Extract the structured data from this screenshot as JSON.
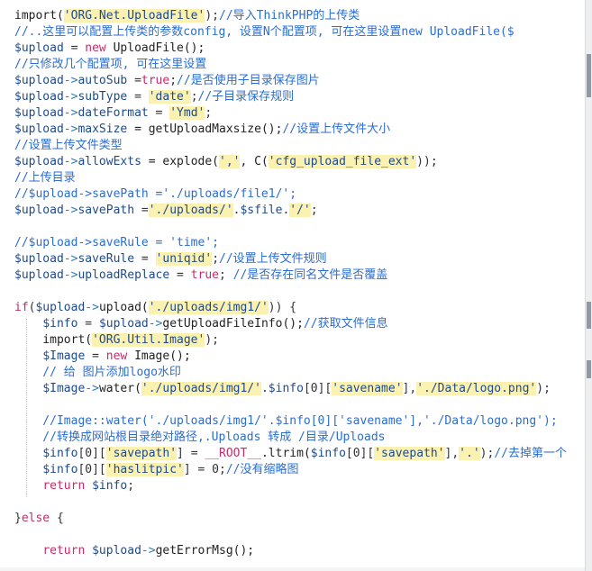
{
  "code_lines": [
    [
      {
        "t": "import(",
        "c": "fn"
      },
      {
        "t": "'ORG.Net.UploadFile'",
        "c": "str"
      },
      {
        "t": ");",
        "c": "opr"
      },
      {
        "t": "//导入ThinkPHP的上传类",
        "c": "cmt"
      }
    ],
    [
      {
        "t": "//..这里可以配置上传类的参数config, 设置N个配置项, 可在这里设置new UploadFile($",
        "c": "cmt"
      }
    ],
    [
      {
        "t": "$upload",
        "c": "var"
      },
      {
        "t": " = ",
        "c": "opr"
      },
      {
        "t": "new",
        "c": "kw"
      },
      {
        "t": " UploadFile();",
        "c": "fn"
      }
    ],
    [
      {
        "t": "//只修改几个配置项, 可在这里设置",
        "c": "cmt"
      }
    ],
    [
      {
        "t": "$upload",
        "c": "var"
      },
      {
        "t": "->",
        "c": "arr"
      },
      {
        "t": "autoSub",
        "c": "var"
      },
      {
        "t": " =",
        "c": "opr"
      },
      {
        "t": "true",
        "c": "kw"
      },
      {
        "t": ";",
        "c": "opr"
      },
      {
        "t": "//是否使用子目录保存图片",
        "c": "cmt"
      }
    ],
    [
      {
        "t": "$upload",
        "c": "var"
      },
      {
        "t": "->",
        "c": "arr"
      },
      {
        "t": "subType",
        "c": "var"
      },
      {
        "t": " = ",
        "c": "opr"
      },
      {
        "t": "'date'",
        "c": "str"
      },
      {
        "t": ";",
        "c": "opr"
      },
      {
        "t": "//子目录保存规则",
        "c": "cmt"
      }
    ],
    [
      {
        "t": "$upload",
        "c": "var"
      },
      {
        "t": "->",
        "c": "arr"
      },
      {
        "t": "dateFormat",
        "c": "var"
      },
      {
        "t": " = ",
        "c": "opr"
      },
      {
        "t": "'Ymd'",
        "c": "str"
      },
      {
        "t": ";",
        "c": "opr"
      }
    ],
    [
      {
        "t": "$upload",
        "c": "var"
      },
      {
        "t": "->",
        "c": "arr"
      },
      {
        "t": "maxSize",
        "c": "var"
      },
      {
        "t": " = getUploadMaxsize();",
        "c": "fn"
      },
      {
        "t": "//设置上传文件大小",
        "c": "cmt"
      }
    ],
    [
      {
        "t": "//设置上传文件类型",
        "c": "cmt"
      }
    ],
    [
      {
        "t": "$upload",
        "c": "var"
      },
      {
        "t": "->",
        "c": "arr"
      },
      {
        "t": "allowExts",
        "c": "var"
      },
      {
        "t": " = explode(",
        "c": "fn"
      },
      {
        "t": "','",
        "c": "str"
      },
      {
        "t": ", C(",
        "c": "fn"
      },
      {
        "t": "'cfg_upload_file_ext'",
        "c": "str"
      },
      {
        "t": "));",
        "c": "opr"
      }
    ],
    [
      {
        "t": "//上传目录",
        "c": "cmt"
      }
    ],
    [
      {
        "t": "//$upload->savePath ='./uploads/file1/';",
        "c": "cmt"
      }
    ],
    [
      {
        "t": "$upload",
        "c": "var"
      },
      {
        "t": "->",
        "c": "arr"
      },
      {
        "t": "savePath",
        "c": "var"
      },
      {
        "t": " =",
        "c": "opr"
      },
      {
        "t": "'./uploads/'",
        "c": "str"
      },
      {
        "t": ".",
        "c": "opr"
      },
      {
        "t": "$sfile",
        "c": "var"
      },
      {
        "t": ".",
        "c": "opr"
      },
      {
        "t": "'/'",
        "c": "str"
      },
      {
        "t": ";",
        "c": "opr"
      }
    ],
    [
      {
        "t": "",
        "c": "opr"
      }
    ],
    [
      {
        "t": "//$upload->saveRule = 'time';",
        "c": "cmt"
      }
    ],
    [
      {
        "t": "$upload",
        "c": "var"
      },
      {
        "t": "->",
        "c": "arr"
      },
      {
        "t": "saveRule",
        "c": "var"
      },
      {
        "t": " = ",
        "c": "opr"
      },
      {
        "t": "'uniqid'",
        "c": "str"
      },
      {
        "t": ";",
        "c": "opr"
      },
      {
        "t": "//设置上传文件规则",
        "c": "cmt"
      }
    ],
    [
      {
        "t": "$upload",
        "c": "var"
      },
      {
        "t": "->",
        "c": "arr"
      },
      {
        "t": "uploadReplace",
        "c": "var"
      },
      {
        "t": " = ",
        "c": "opr"
      },
      {
        "t": "true",
        "c": "kw"
      },
      {
        "t": "; ",
        "c": "opr"
      },
      {
        "t": "//是否存在同名文件是否覆盖",
        "c": "cmt"
      }
    ],
    [
      {
        "t": "",
        "c": "opr"
      }
    ],
    [
      {
        "t": "if",
        "c": "kw"
      },
      {
        "t": "(",
        "c": "opr"
      },
      {
        "t": "$upload",
        "c": "var"
      },
      {
        "t": "->",
        "c": "arr"
      },
      {
        "t": "upload(",
        "c": "fn"
      },
      {
        "t": "'./uploads/img1/'",
        "c": "str"
      },
      {
        "t": ")) {",
        "c": "opr"
      }
    ],
    [
      {
        "t": "    ",
        "c": "opr"
      },
      {
        "t": "$info",
        "c": "var"
      },
      {
        "t": " = ",
        "c": "opr"
      },
      {
        "t": "$upload",
        "c": "var"
      },
      {
        "t": "->",
        "c": "arr"
      },
      {
        "t": "getUploadFileInfo();",
        "c": "fn"
      },
      {
        "t": "//获取文件信息",
        "c": "cmt"
      }
    ],
    [
      {
        "t": "    import(",
        "c": "fn"
      },
      {
        "t": "'ORG.Util.Image'",
        "c": "str"
      },
      {
        "t": ");",
        "c": "opr"
      }
    ],
    [
      {
        "t": "    ",
        "c": "opr"
      },
      {
        "t": "$Image",
        "c": "var"
      },
      {
        "t": " = ",
        "c": "opr"
      },
      {
        "t": "new",
        "c": "kw"
      },
      {
        "t": " Image();",
        "c": "fn"
      }
    ],
    [
      {
        "t": "    // 给 图片添加logo水印",
        "c": "cmt"
      }
    ],
    [
      {
        "t": "    ",
        "c": "opr"
      },
      {
        "t": "$Image",
        "c": "var"
      },
      {
        "t": "->",
        "c": "arr"
      },
      {
        "t": "water(",
        "c": "fn"
      },
      {
        "t": "'./uploads/img1/'",
        "c": "str"
      },
      {
        "t": ".",
        "c": "opr"
      },
      {
        "t": "$info",
        "c": "var"
      },
      {
        "t": "[0][",
        "c": "opr"
      },
      {
        "t": "'savename'",
        "c": "str"
      },
      {
        "t": "],",
        "c": "opr"
      },
      {
        "t": "'./Data/logo.png'",
        "c": "str"
      },
      {
        "t": ");",
        "c": "opr"
      }
    ],
    [
      {
        "t": "",
        "c": "opr"
      }
    ],
    [
      {
        "t": "    //Image::water('./uploads/img1/'.$info[0]['savename'],'./Data/logo.png');",
        "c": "cmt"
      }
    ],
    [
      {
        "t": "    //转换成网站根目录绝对路径,.Uploads 转成 /目录/Uploads",
        "c": "cmt"
      }
    ],
    [
      {
        "t": "    ",
        "c": "opr"
      },
      {
        "t": "$info",
        "c": "var"
      },
      {
        "t": "[0][",
        "c": "opr"
      },
      {
        "t": "'savepath'",
        "c": "str"
      },
      {
        "t": "] = ",
        "c": "opr"
      },
      {
        "t": "__ROOT__",
        "c": "kw"
      },
      {
        "t": ".ltrim(",
        "c": "fn"
      },
      {
        "t": "$info",
        "c": "var"
      },
      {
        "t": "[0][",
        "c": "opr"
      },
      {
        "t": "'savepath'",
        "c": "str"
      },
      {
        "t": "],",
        "c": "opr"
      },
      {
        "t": "'.'",
        "c": "str"
      },
      {
        "t": ");",
        "c": "opr"
      },
      {
        "t": "//去掉第一个",
        "c": "cmt"
      }
    ],
    [
      {
        "t": "    ",
        "c": "opr"
      },
      {
        "t": "$info",
        "c": "var"
      },
      {
        "t": "[0][",
        "c": "opr"
      },
      {
        "t": "'haslitpic'",
        "c": "str"
      },
      {
        "t": "] = 0;",
        "c": "opr"
      },
      {
        "t": "//没有缩略图",
        "c": "cmt"
      }
    ],
    [
      {
        "t": "    ",
        "c": "opr"
      },
      {
        "t": "return",
        "c": "kw"
      },
      {
        "t": " ",
        "c": "opr"
      },
      {
        "t": "$info",
        "c": "var"
      },
      {
        "t": ";",
        "c": "opr"
      }
    ],
    [
      {
        "t": "",
        "c": "opr"
      }
    ],
    [
      {
        "t": "}",
        "c": "opr"
      },
      {
        "t": "else",
        "c": "kw"
      },
      {
        "t": " {",
        "c": "opr"
      }
    ],
    [
      {
        "t": "",
        "c": "opr"
      }
    ],
    [
      {
        "t": "    ",
        "c": "opr"
      },
      {
        "t": "return",
        "c": "kw"
      },
      {
        "t": " ",
        "c": "opr"
      },
      {
        "t": "$upload",
        "c": "var"
      },
      {
        "t": "->",
        "c": "arr"
      },
      {
        "t": "getErrorMsg();",
        "c": "fn"
      }
    ]
  ]
}
